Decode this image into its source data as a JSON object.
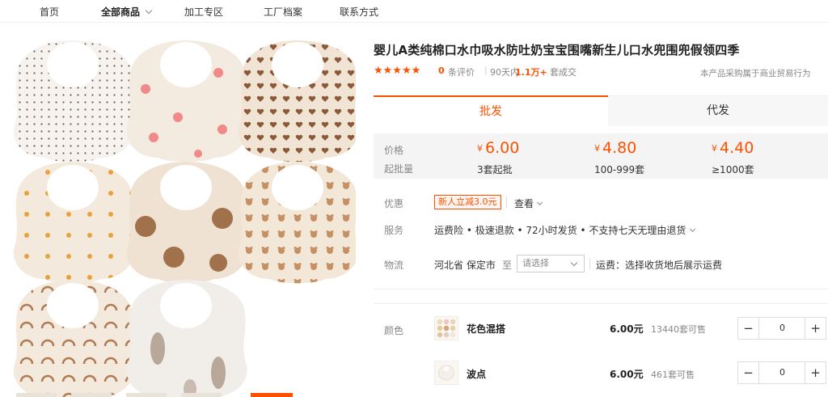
{
  "nav": {
    "items": [
      "首页",
      "全部商品",
      "加工专区",
      "工厂档案",
      "联系方式"
    ]
  },
  "product": {
    "title": "婴儿A类纯棉口水巾吸水防吐奶宝宝围嘴新生儿口水兜围兜假领四季",
    "stars": "★★★★★",
    "reviews_count": "0",
    "reviews_label": "条评价",
    "days_label": "90天内",
    "volume": "1.1万+",
    "deal_label": "套成交",
    "notice": "本产品采购属于商业贸易行为"
  },
  "tabs": [
    "批发",
    "代发"
  ],
  "pricing": {
    "price_label": "价格",
    "qty_label": "起批量",
    "currency": "¥",
    "tiers": [
      {
        "price": "6.00",
        "qty": "3套起批"
      },
      {
        "price": "4.80",
        "qty": "100-999套"
      },
      {
        "price": "4.40",
        "qty": "≥1000套"
      }
    ]
  },
  "promo": {
    "label": "优惠",
    "coupon": "新人立减3.0元",
    "view_more": "查看"
  },
  "service": {
    "label": "服务",
    "text": "运费险 • 极速退款 • 72小时发货 • 不支持七天无理由退货"
  },
  "logistics": {
    "label": "物流",
    "origin": "河北省 保定市",
    "to": "至",
    "select_placeholder": "请选择",
    "freight": "运费：选择收货地后展示运费"
  },
  "color": {
    "label": "颜色",
    "skus": [
      {
        "name": "花色混搭",
        "price": "6.00元",
        "stock": "13440套可售",
        "qty": "0"
      },
      {
        "name": "波点",
        "price": "6.00元",
        "stock": "461套可售",
        "qty": "0"
      }
    ]
  },
  "colors": {
    "accent": "#ff5000",
    "bib_cream": "#f3e9dc",
    "bib_pink": "#f08a8a",
    "bib_brown": "#a0714a"
  }
}
